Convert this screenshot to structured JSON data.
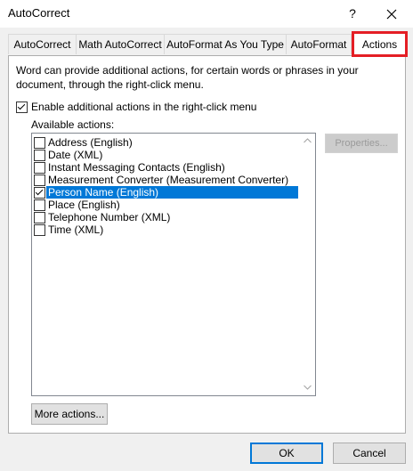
{
  "window": {
    "title": "AutoCorrect",
    "help_label": "?",
    "close_label": "✕"
  },
  "tabs": [
    {
      "label": "AutoCorrect",
      "active": false
    },
    {
      "label": "Math AutoCorrect",
      "active": false
    },
    {
      "label": "AutoFormat As You Type",
      "active": false
    },
    {
      "label": "AutoFormat",
      "active": false
    },
    {
      "label": "Actions",
      "active": true
    }
  ],
  "highlight_color": "#e41e25",
  "actions_panel": {
    "description": "Word can provide additional actions, for certain words or phrases in your document, through the right-click menu.",
    "enable_checkbox": {
      "label": "Enable additional actions in the right-click menu",
      "checked": true
    },
    "available_label": "Available actions:",
    "actions": [
      {
        "label": "Address (English)",
        "checked": false,
        "selected": false
      },
      {
        "label": "Date (XML)",
        "checked": false,
        "selected": false
      },
      {
        "label": "Instant Messaging Contacts (English)",
        "checked": false,
        "selected": false
      },
      {
        "label": "Measurement Converter (Measurement Converter)",
        "checked": false,
        "selected": false
      },
      {
        "label": "Person Name (English)",
        "checked": true,
        "selected": true
      },
      {
        "label": "Place (English)",
        "checked": false,
        "selected": false
      },
      {
        "label": "Telephone Number (XML)",
        "checked": false,
        "selected": false
      },
      {
        "label": "Time (XML)",
        "checked": false,
        "selected": false
      }
    ],
    "properties_button": "Properties...",
    "more_actions_button": "More actions..."
  },
  "footer": {
    "ok": "OK",
    "cancel": "Cancel"
  }
}
